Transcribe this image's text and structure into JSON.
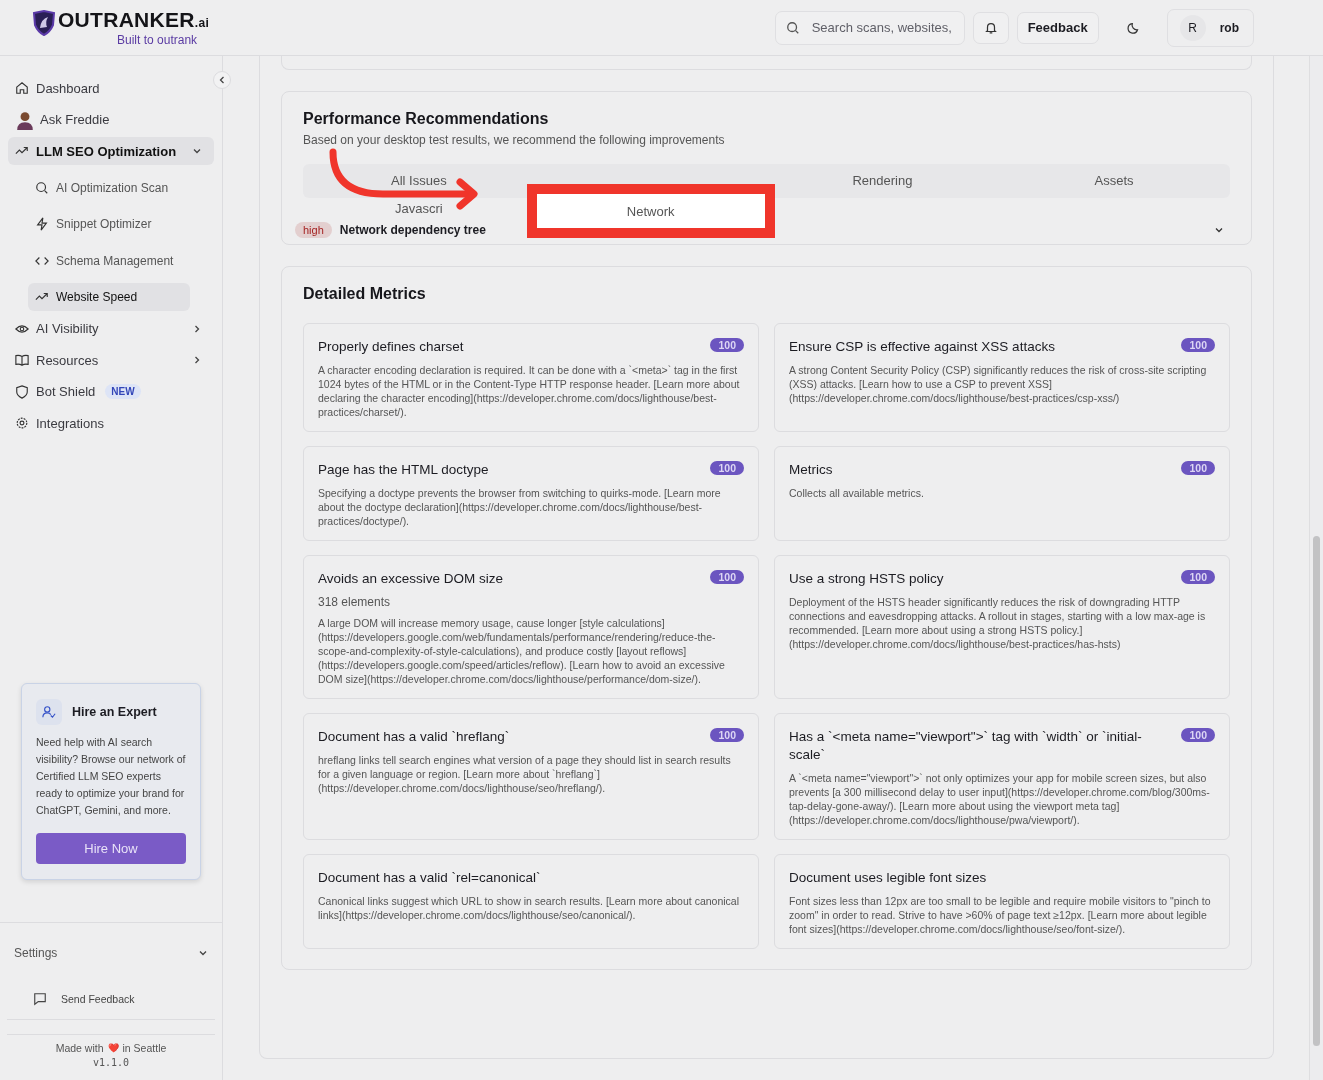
{
  "logo": {
    "name": "OUTRANKER",
    "suffix": ".ai",
    "tagline": "Built to outrank"
  },
  "header": {
    "search": {
      "placeholder": "Search scans, websites,"
    },
    "feedback": "Feedback",
    "user": {
      "initial": "R",
      "name": "rob"
    }
  },
  "nav": [
    {
      "label": "Dashboard",
      "selected": false
    },
    {
      "label": "Ask Freddie",
      "selected": false
    },
    {
      "label": "LLM SEO Optimization",
      "selected": true,
      "expanded": true,
      "children": [
        {
          "label": "AI Optimization Scan",
          "selected": false
        },
        {
          "label": "Snippet Optimizer",
          "selected": false
        },
        {
          "label": "Schema Management",
          "selected": false
        },
        {
          "label": "Website Speed",
          "selected": true
        }
      ]
    },
    {
      "label": "AI Visibility",
      "selected": false,
      "expanded": false
    },
    {
      "label": "Resources",
      "selected": false,
      "expanded": false
    },
    {
      "label": "Bot Shield",
      "selected": false,
      "badge": "NEW"
    },
    {
      "label": "Integrations",
      "selected": false
    }
  ],
  "promo": {
    "title": "Hire an Expert",
    "text": "Need help with AI search visibility? Browse our network of Certified LLM SEO experts ready to optimize your brand for ChatGPT, Gemini, and more.",
    "button": "Hire Now"
  },
  "settings": {
    "label": "Settings",
    "expanded": false
  },
  "send_feedback": "Send Feedback",
  "footer": {
    "made_with": "Made with",
    "heart": "❤️",
    "place": "in Seattle",
    "version": "v1.1.0"
  },
  "recommendations": {
    "title": "Performance Recommendations",
    "subtitle": "Based on your desktop test results, we recommend the following improvements",
    "tabs": [
      {
        "label": "All Issues",
        "selected": false
      },
      {
        "label": "Rendering",
        "selected": false
      },
      {
        "label": "Assets",
        "selected": false
      },
      {
        "label": "Javascri",
        "selected": false
      },
      {
        "label": "Network",
        "selected": true
      }
    ],
    "issue": {
      "severity": "high",
      "title": "Network dependency tree",
      "expanded": false
    }
  },
  "metrics": {
    "title": "Detailed Metrics",
    "cards": [
      {
        "title": "Properly defines charset",
        "score": "100",
        "description": "A character encoding declaration is required. It can be done with a `<meta>` tag in the first 1024 bytes of the HTML or in the Content-Type HTTP response header. [Learn more about declaring the character encoding](https://developer.chrome.com/docs/lighthouse/best-practices/charset/)."
      },
      {
        "title": "Ensure CSP is effective against XSS attacks",
        "score": "100",
        "description": "A strong Content Security Policy (CSP) significantly reduces the risk of cross-site scripting (XSS) attacks. [Learn how to use a CSP to prevent XSS](https://developer.chrome.com/docs/lighthouse/best-practices/csp-xss/)"
      },
      {
        "title": "Page has the HTML doctype",
        "score": "100",
        "description": "Specifying a doctype prevents the browser from switching to quirks-mode. [Learn more about the doctype declaration](https://developer.chrome.com/docs/lighthouse/best-practices/doctype/)."
      },
      {
        "title": "Metrics",
        "score": "100",
        "description": "Collects all available metrics."
      },
      {
        "title": "Avoids an excessive DOM size",
        "score": "100",
        "subtitle": "318 elements",
        "description": "A large DOM will increase memory usage, cause longer [style calculations](https://developers.google.com/web/fundamentals/performance/rendering/reduce-the-scope-and-complexity-of-style-calculations), and produce costly [layout reflows](https://developers.google.com/speed/articles/reflow). [Learn how to avoid an excessive DOM size](https://developer.chrome.com/docs/lighthouse/performance/dom-size/)."
      },
      {
        "title": "Use a strong HSTS policy",
        "score": "100",
        "description": "Deployment of the HSTS header significantly reduces the risk of downgrading HTTP connections and eavesdropping attacks. A rollout in stages, starting with a low max-age is recommended. [Learn more about using a strong HSTS policy.](https://developer.chrome.com/docs/lighthouse/best-practices/has-hsts)"
      },
      {
        "title": "Document has a valid `hreflang`",
        "score": "100",
        "description": "hreflang links tell search engines what version of a page they should list in search results for a given language or region. [Learn more about `hreflang`](https://developer.chrome.com/docs/lighthouse/seo/hreflang/)."
      },
      {
        "title": "Has a `<meta name=\"viewport\">` tag with `width` or `initial-scale`",
        "score": "100",
        "description": "A `<meta name=\"viewport\">` not only optimizes your app for mobile screen sizes, but also prevents [a 300 millisecond delay to user input](https://developer.chrome.com/blog/300ms-tap-delay-gone-away/). [Learn more about using the viewport meta tag](https://developer.chrome.com/docs/lighthouse/pwa/viewport/)."
      },
      {
        "title": "Document has a valid `rel=canonical`",
        "description": "Canonical links suggest which URL to show in search results. [Learn more about canonical links](https://developer.chrome.com/docs/lighthouse/seo/canonical/)."
      },
      {
        "title": "Document uses legible font sizes",
        "description": "Font sizes less than 12px are too small to be legible and require mobile visitors to \"pinch to zoom\" in order to read. Strive to have >60% of page text ≥12px. [Learn more about legible font sizes](https://developer.chrome.com/docs/lighthouse/seo/font-size/)."
      }
    ]
  }
}
